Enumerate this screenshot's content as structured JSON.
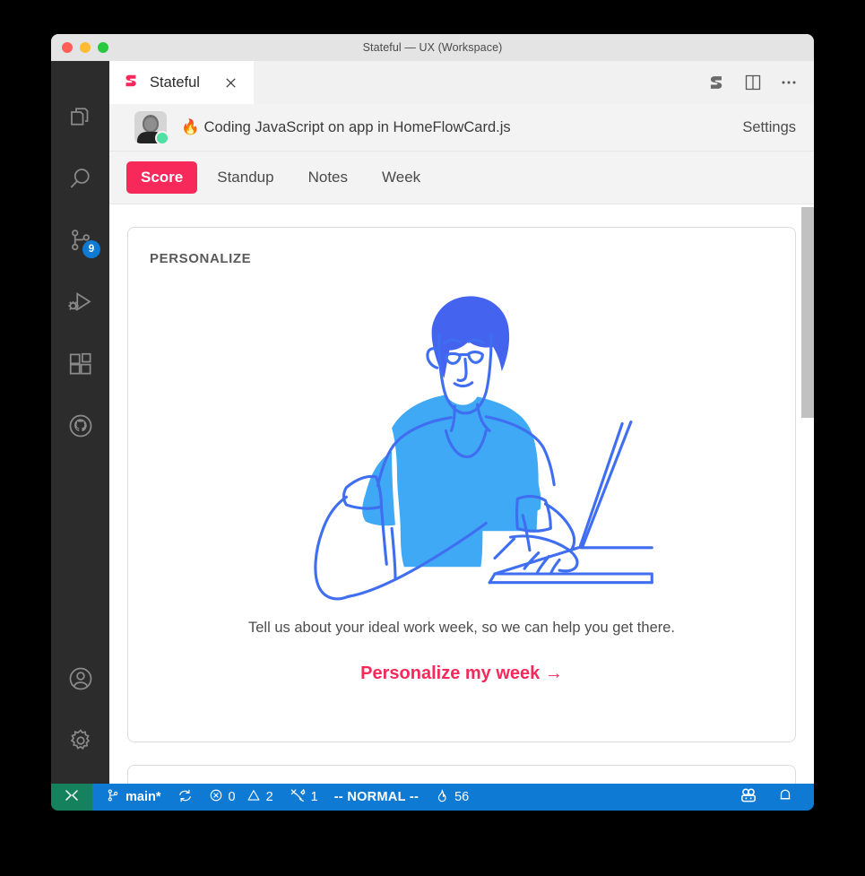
{
  "window": {
    "title": "Stateful — UX (Workspace)",
    "traffic_lights": [
      "close",
      "minimize",
      "zoom"
    ]
  },
  "activity_bar": {
    "top_items": [
      {
        "name": "explorer",
        "icon": "files-icon",
        "badge": null
      },
      {
        "name": "search",
        "icon": "search-icon",
        "badge": null
      },
      {
        "name": "source-control",
        "icon": "source-control-icon",
        "badge": "9"
      },
      {
        "name": "run-and-debug",
        "icon": "run-debug-icon",
        "badge": null
      },
      {
        "name": "extensions",
        "icon": "extensions-icon",
        "badge": null
      },
      {
        "name": "github",
        "icon": "github-icon",
        "badge": null
      }
    ],
    "bottom_items": [
      {
        "name": "accounts",
        "icon": "account-icon"
      },
      {
        "name": "manage",
        "icon": "gear-icon"
      }
    ]
  },
  "editor_tab": {
    "label": "Stateful",
    "icon": "stateful-logo-icon",
    "close_icon": "close-icon",
    "actions": [
      {
        "name": "stateful-panel",
        "icon": "stateful-logo-icon"
      },
      {
        "name": "split-editor",
        "icon": "split-editor-icon"
      },
      {
        "name": "more-actions",
        "icon": "ellipsis-icon"
      }
    ]
  },
  "header": {
    "avatar": "user-avatar",
    "online": true,
    "status_emoji": "🔥",
    "status_text": "Coding JavaScript on app in HomeFlowCard.js",
    "settings_label": "Settings"
  },
  "nav_tabs": [
    {
      "label": "Score",
      "active": true
    },
    {
      "label": "Standup",
      "active": false
    },
    {
      "label": "Notes",
      "active": false
    },
    {
      "label": "Week",
      "active": false
    }
  ],
  "card": {
    "title": "PERSONALIZE",
    "illustration": "person-at-laptop-illustration",
    "caption": "Tell us about your ideal work week, so we can help you get there.",
    "cta": "Personalize my week  →"
  },
  "status_bar": {
    "remote_icon": "remote-window-icon",
    "branch": "main*",
    "sync_icon": "sync-icon",
    "errors": "0",
    "warnings": "2",
    "ports_icon": "ports-icon",
    "ports": "1",
    "mode": "-- NORMAL --",
    "streak_icon": "flame-icon",
    "streak": "56",
    "right_icons": [
      {
        "name": "live-share-icon"
      },
      {
        "name": "bell-icon"
      }
    ]
  },
  "colors": {
    "accent_pink": "#f6295a",
    "status_blue": "#0e7ad4",
    "remote_green": "#16825d",
    "badge_blue": "#0e7ad4",
    "illustration_blue": "#4464f0",
    "illustration_shirt": "#3fa9f5",
    "online_green": "#4fe0a5"
  }
}
